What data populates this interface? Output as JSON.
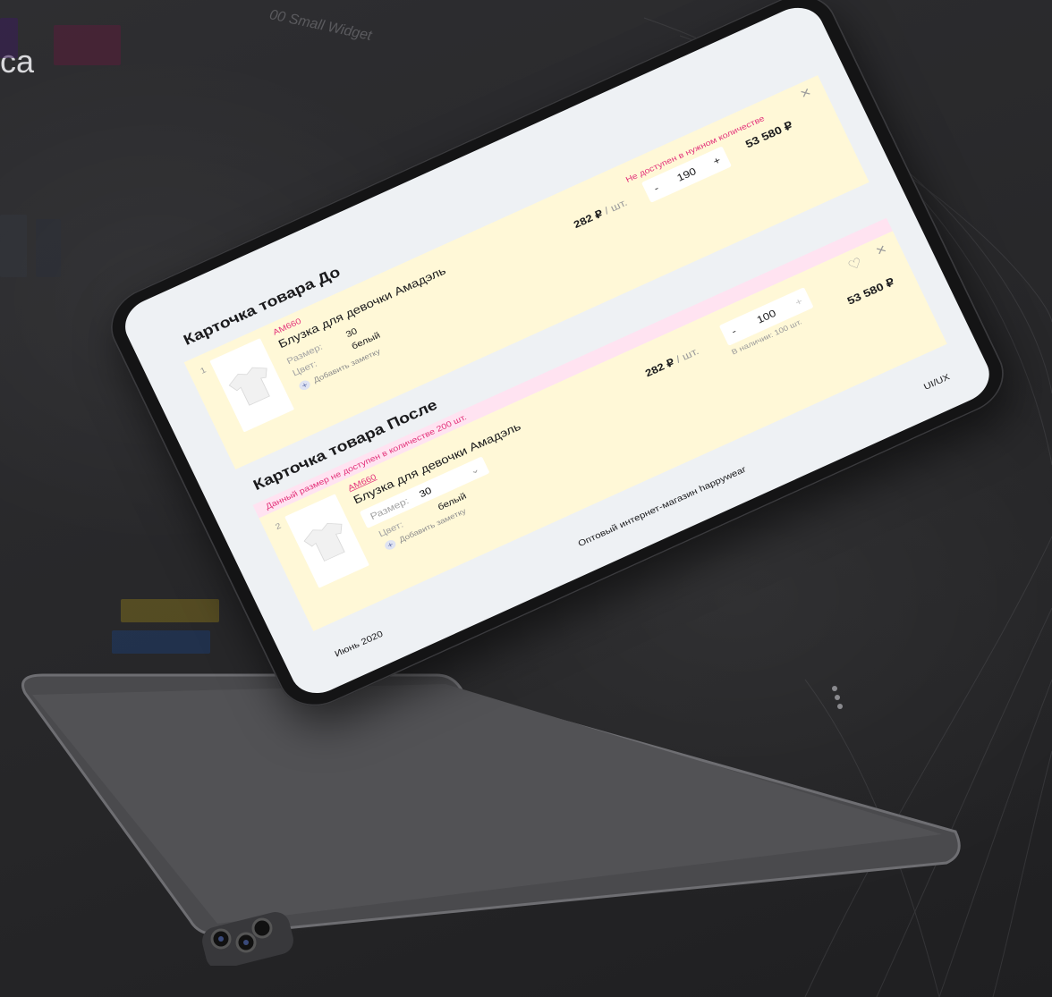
{
  "background": {
    "partial_title": "са",
    "widget_label": "00 Small Widget"
  },
  "screen": {
    "before": {
      "heading": "Карточка товара До",
      "index": "1",
      "sku": "AM660",
      "product_name": "Блузка для девочки Амадэль",
      "size_label": "Размер:",
      "size_value": "30",
      "color_label": "Цвет:",
      "color_value": "белый",
      "add_note": "Добавить заметку",
      "unit_price": "282 ₽",
      "unit_suffix": "/ шт.",
      "qty_minus": "-",
      "qty_value": "190",
      "qty_plus": "+",
      "warning": "Не доступен в нужном количестве",
      "total": "53 580 ₽",
      "close_icon": "×"
    },
    "after": {
      "heading": "Карточка товара После",
      "banner": "Данный размер не доступен в количестве 200 шт.",
      "index": "2",
      "sku": "AM660",
      "product_name": "Блузка для девочки Амадэль",
      "size_label": "Размер:",
      "size_value": "30",
      "color_label": "Цвет:",
      "color_value": "белый",
      "add_note": "Добавить заметку",
      "unit_price": "282 ₽",
      "unit_suffix": "/ шт.",
      "qty_minus": "-",
      "qty_value": "100",
      "qty_plus": "+",
      "stock": "В наличии: 100 шт.",
      "total": "53 580 ₽",
      "close_icon": "×",
      "heart_icon": "♡",
      "chevron_icon": "⌄"
    },
    "footer": {
      "shop": "Оптовый интернет-магазин happywear",
      "date": "Июнь 2020",
      "tag": "UI/UX"
    }
  },
  "colors": {
    "card": "#fff8d7",
    "pink_banner": "#ffe3f1",
    "accent": "#e3327a",
    "screen_bg": "#eef1f4"
  }
}
